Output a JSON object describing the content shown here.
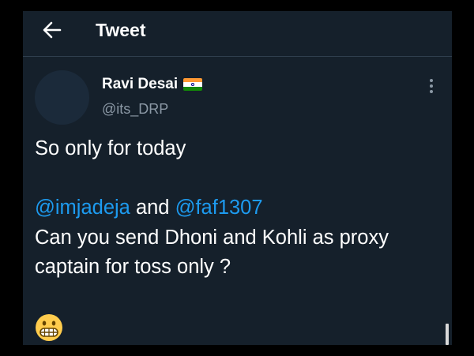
{
  "header": {
    "title": "Tweet",
    "back_icon": "arrow-left-icon"
  },
  "author": {
    "name": "Ravi Desai",
    "flag_icon": "india-flag-icon",
    "handle": "@its_DRP",
    "more_icon": "more-vertical-icon"
  },
  "tweet": {
    "line1": "So only for today",
    "mention1": "@imjadeja",
    "connector": " and ",
    "mention2": "@faf1307",
    "line3": "Can you send Dhoni and Kohli as proxy",
    "line4": "captain for toss only ?",
    "emoji_icon": "grimacing-face-emoji"
  },
  "colors": {
    "background": "#15202b",
    "text": "#ffffff",
    "secondary_text": "#8b98a5",
    "link": "#1d9bf0"
  }
}
